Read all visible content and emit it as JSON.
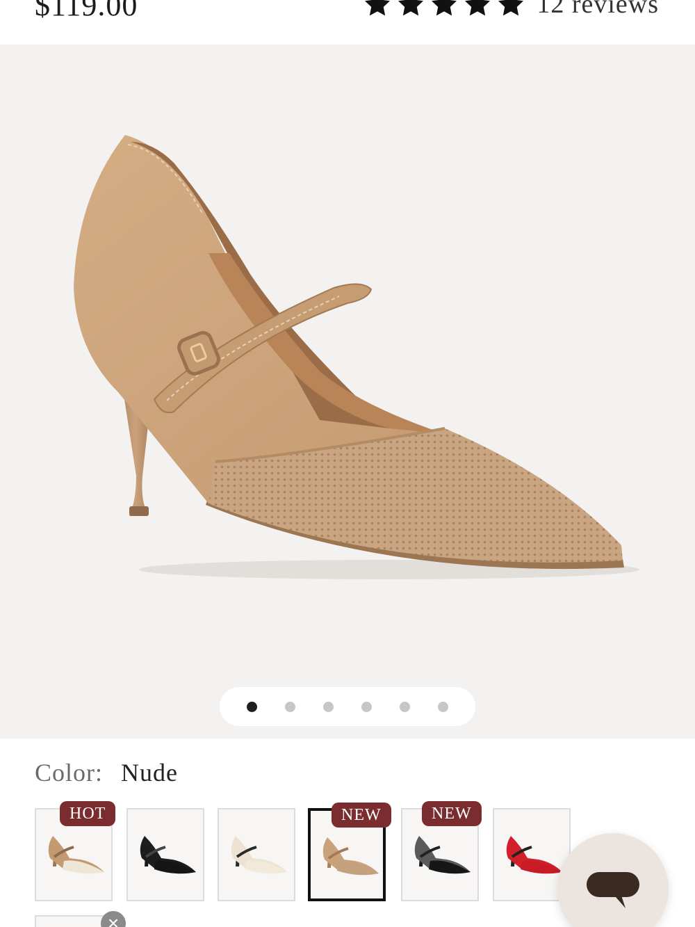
{
  "header": {
    "price": "$119.00",
    "rating_stars": 5,
    "reviews_label": "12 reviews"
  },
  "gallery": {
    "image_alt": "Nude mary jane pointed-toe stiletto pump",
    "total_images": 6,
    "active_index": 0
  },
  "color": {
    "label": "Color:",
    "value": "Nude"
  },
  "swatches": [
    {
      "name": "nude-cream",
      "badge": "HOT",
      "selected": false
    },
    {
      "name": "black",
      "badge": "",
      "selected": false
    },
    {
      "name": "cream",
      "badge": "",
      "selected": false
    },
    {
      "name": "nude",
      "badge": "NEW",
      "selected": true
    },
    {
      "name": "black-sequin",
      "badge": "NEW",
      "selected": false
    },
    {
      "name": "red",
      "badge": "",
      "selected": false
    }
  ],
  "colors": {
    "badge_bg": "#7a2c2e",
    "gallery_bg": "#f3f2f0",
    "dot_active": "#1f1f1f",
    "dot_inactive": "#c6c6c6",
    "chat_bg": "#ece5df",
    "chat_icon": "#3a2a1f"
  },
  "icons": {
    "rating": "star-icon",
    "chat": "chat-bubble-icon",
    "remove": "close-icon"
  },
  "remove_symbol": "×"
}
